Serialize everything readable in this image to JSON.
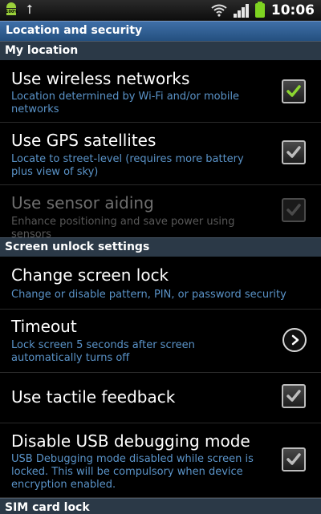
{
  "status_bar": {
    "time": "10:06",
    "battery_icon_label": "100%",
    "icons": [
      "android-icon",
      "usb-icon",
      "wifi-icon",
      "signal-icon",
      "battery-icon"
    ],
    "battery_level": 1.0
  },
  "header": {
    "title": "Location and security"
  },
  "sections": {
    "my_location": "My location",
    "screen_unlock": "Screen unlock settings",
    "sim_card": "SIM card lock"
  },
  "items": {
    "wireless": {
      "title": "Use wireless networks",
      "subtitle": "Location determined by Wi-Fi and/or mobile networks",
      "checked": true,
      "enabled": true
    },
    "gps": {
      "title": "Use GPS satellites",
      "subtitle": "Locate to street-level (requires more battery plus view of sky)",
      "checked": true,
      "enabled": true
    },
    "sensor": {
      "title": "Use sensor aiding",
      "subtitle": "Enhance positioning and save power using sensors",
      "checked": true,
      "enabled": false
    },
    "screen_lock": {
      "title": "Change screen lock",
      "subtitle": "Change or disable pattern, PIN, or password security"
    },
    "timeout": {
      "title": "Timeout",
      "subtitle": "Lock screen 5 seconds after screen automatically turns off"
    },
    "tactile": {
      "title": "Use tactile feedback",
      "checked": true,
      "enabled": true
    },
    "usb_debug": {
      "title": "Disable USB debugging mode",
      "subtitle": "USB Debugging mode disabled while screen is locked. This will be compulsory when device encryption enabled.",
      "checked": true,
      "enabled": true
    }
  },
  "colors": {
    "title_bar": "#2f5f96",
    "section_header": "#2b3947",
    "subtitle_text": "#5a93c8",
    "check_active": "#8cd630",
    "check_inactive": "#bdbdbd",
    "disabled_text": "#6f6f6f"
  }
}
